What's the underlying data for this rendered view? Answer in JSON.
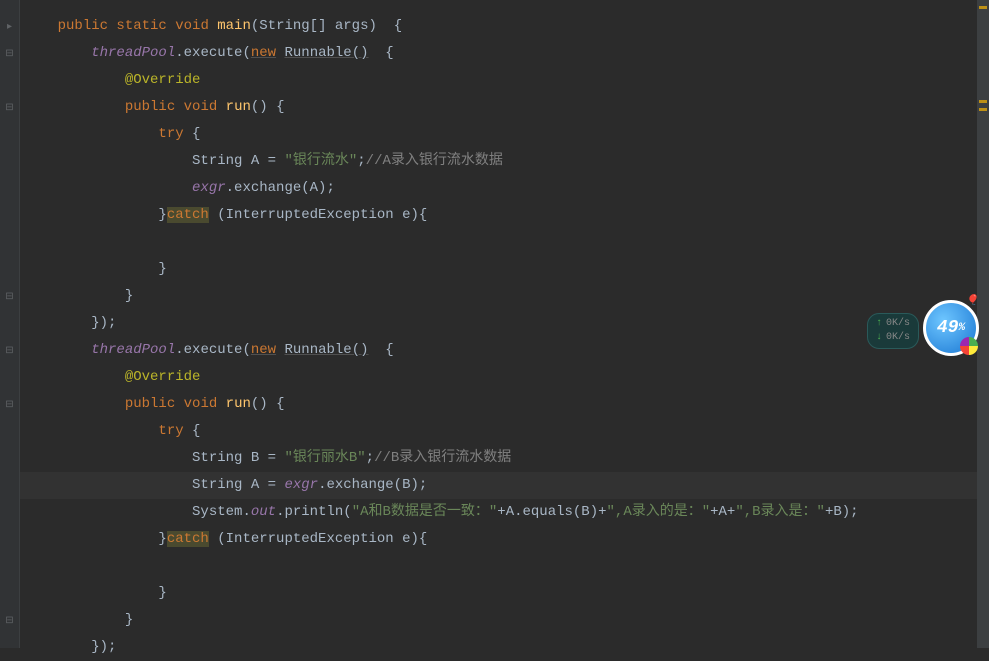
{
  "code": {
    "l1": {
      "kw1": "public static",
      "kw2": "void",
      "method": "main",
      "params": "(String[] args)",
      "brace": "  {"
    },
    "l2": {
      "field": "threadPool",
      "call": ".execute(",
      "kw": "new",
      "runnable": "Runnable()",
      "brace": "  {"
    },
    "l3": {
      "ann": "@Override"
    },
    "l4": {
      "kw1": "public",
      "kw2": "void",
      "method": "run",
      "paren": "()",
      "brace": " {"
    },
    "l5": {
      "kw": "try",
      "brace": " {"
    },
    "l6": {
      "decl": "String A = ",
      "str": "\"银行流水\"",
      "semi": ";",
      "comment": "//A录入银行流水数据"
    },
    "l7": {
      "field": "exgr",
      "call": ".exchange(A)",
      "semi": ";"
    },
    "l8": {
      "brace": "}",
      "kw": "catch",
      "catch": " (InterruptedException e){"
    },
    "l9": {
      "brace": "}"
    },
    "l10": {
      "brace": "}"
    },
    "l11": {
      "brace": "})",
      "semi": ";"
    },
    "l12": {
      "field": "threadPool",
      "call": ".execute(",
      "kw": "new",
      "runnable": "Runnable()",
      "brace": "  {"
    },
    "l13": {
      "ann": "@Override"
    },
    "l14": {
      "kw1": "public",
      "kw2": "void",
      "method": "run",
      "paren": "()",
      "brace": " {"
    },
    "l15": {
      "kw": "try",
      "brace": " {"
    },
    "l16": {
      "decl": "String B = ",
      "str": "\"银行丽水B\"",
      "semi": ";",
      "comment": "//B录入银行流水数据"
    },
    "l17": {
      "decl": "String A = ",
      "field": "exgr",
      "call": ".exchange(B)",
      "semi": ";"
    },
    "l18": {
      "sys": "System.",
      "out": "out",
      "call": ".println(",
      "str1": "\"A和B数据是否一致：\"",
      "plus1": "+A.equals(B)+",
      "str2": "\",A录入的是：\"",
      "plus2": "+A+",
      "str3": "\",B录入是：\"",
      "plus3": "+B)",
      "semi": ";"
    },
    "l19": {
      "brace": "}",
      "kw": "catch",
      "catch": " (InterruptedException e){"
    },
    "l20": {
      "brace": "}"
    },
    "l21": {
      "brace": "}"
    },
    "l22": {
      "brace": "})",
      "semi": ";"
    }
  },
  "indents": {
    "i1": "    ",
    "i2": "        ",
    "i3": "            ",
    "i4": "                ",
    "i5": "                    "
  },
  "net": {
    "up": "0K/s",
    "down": "0K/s"
  },
  "badge": {
    "value": "49",
    "pct": "%"
  }
}
